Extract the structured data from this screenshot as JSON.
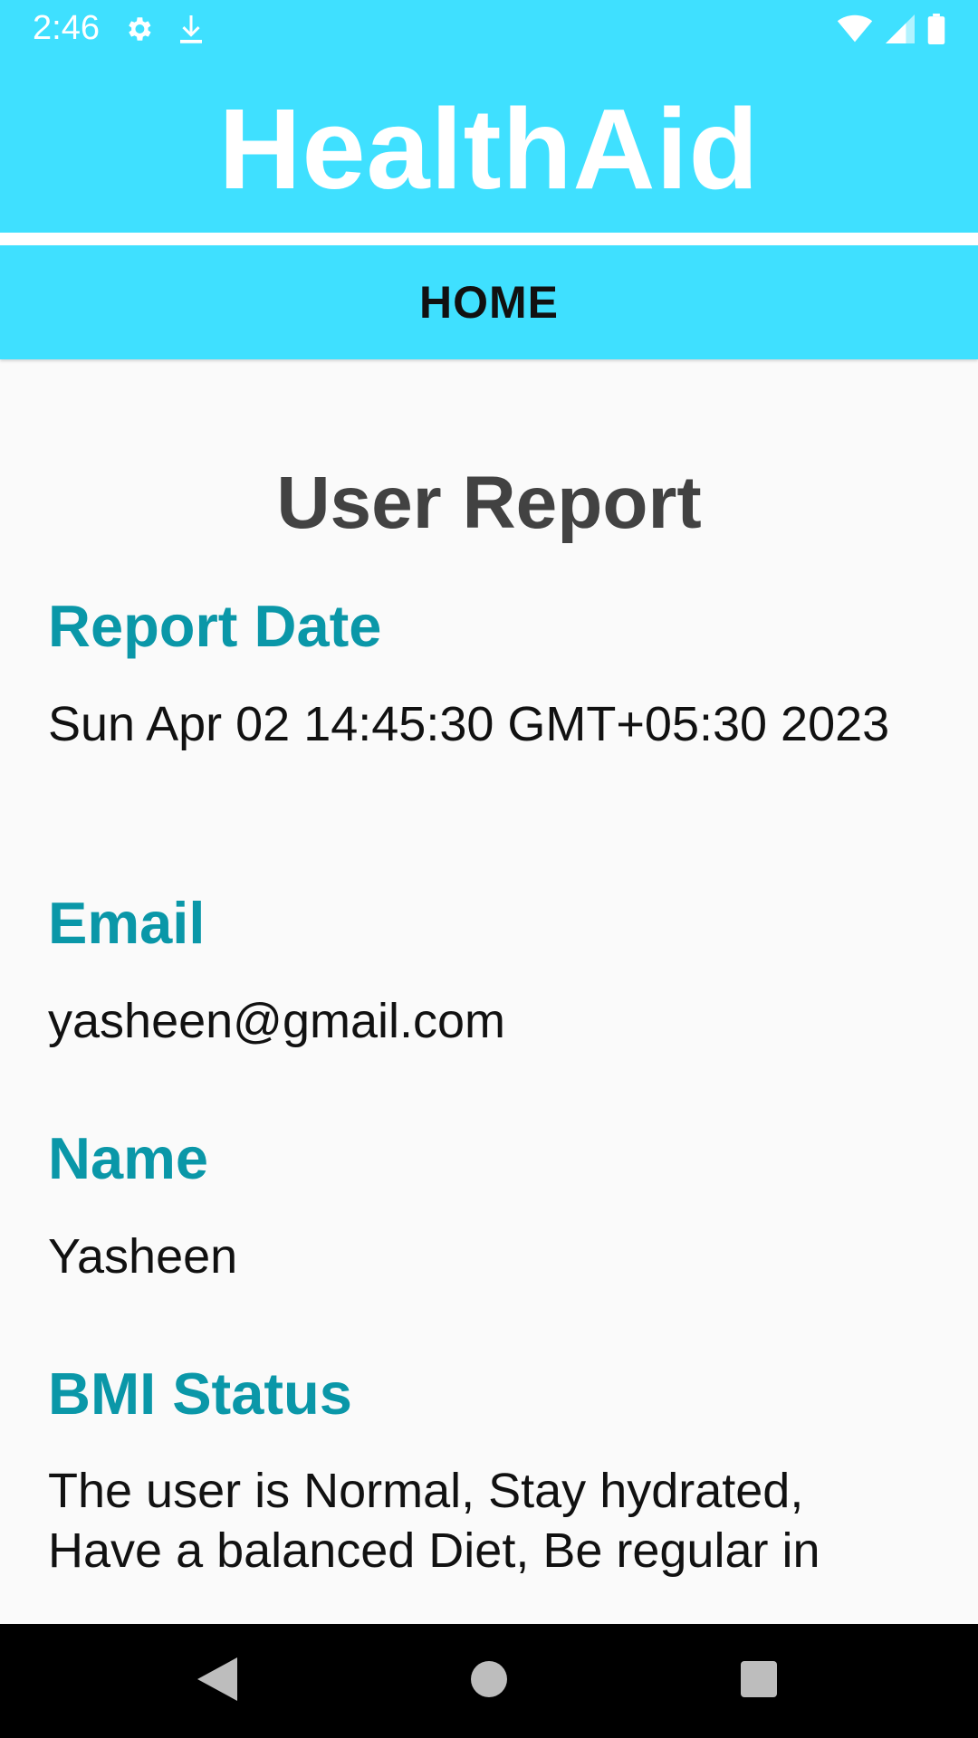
{
  "status_bar": {
    "time": "2:46",
    "icons_left": [
      "gear-icon",
      "download-icon"
    ],
    "icons_right": [
      "wifi-icon",
      "signal-icon",
      "battery-icon"
    ]
  },
  "app": {
    "title": "HealthAid",
    "brand_color": "#3fe0ff"
  },
  "tabs": [
    {
      "label": "HOME",
      "selected": true
    }
  ],
  "report": {
    "heading": "User Report",
    "label_color": "#0a97a8",
    "fields": [
      {
        "label": "Report Date",
        "value": "Sun Apr 02 14:45:30 GMT+05:30 2023"
      },
      {
        "label": "Email",
        "value": "yasheen@gmail.com"
      },
      {
        "label": "Name",
        "value": "Yasheen"
      },
      {
        "label": "BMI Status",
        "value": "The user is Normal, Stay hydrated, Have a balanced Diet, Be regular in"
      }
    ]
  },
  "nav_bar": {
    "buttons": [
      "back-icon",
      "home-icon",
      "recents-icon"
    ]
  }
}
